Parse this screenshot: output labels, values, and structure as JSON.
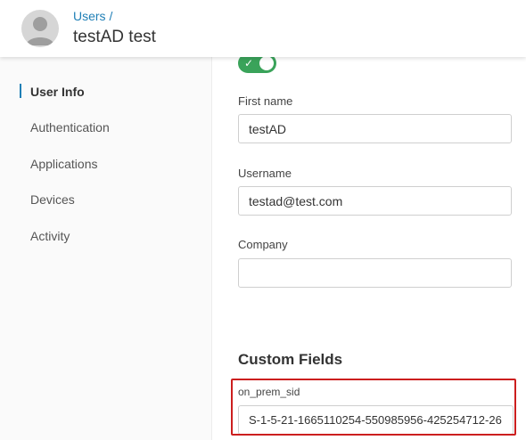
{
  "header": {
    "breadcrumb": "Users /",
    "title": "testAD test"
  },
  "sidebar": {
    "items": [
      {
        "label": "User Info",
        "active": true
      },
      {
        "label": "Authentication",
        "active": false
      },
      {
        "label": "Applications",
        "active": false
      },
      {
        "label": "Devices",
        "active": false
      },
      {
        "label": "Activity",
        "active": false
      }
    ]
  },
  "form": {
    "status_toggle": {
      "on": true,
      "icon": "check-icon"
    },
    "first_name": {
      "label": "First name",
      "value": "testAD"
    },
    "username": {
      "label": "Username",
      "value": "testad@test.com"
    },
    "company": {
      "label": "Company",
      "value": ""
    }
  },
  "custom_fields": {
    "title": "Custom Fields",
    "on_prem_sid": {
      "label": "on_prem_sid",
      "value": "S-1-5-21-1665110254-550985956-425254712-26"
    }
  },
  "colors": {
    "accent": "#1f7fb6",
    "toggle_on": "#3aa35a",
    "highlight": "#cc1f1f"
  }
}
